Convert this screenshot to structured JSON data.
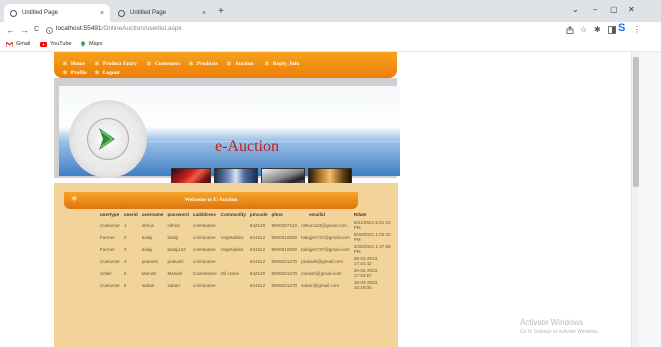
{
  "browser": {
    "tabs": [
      {
        "title": "Untitled Page",
        "close": "×"
      },
      {
        "title": "Untitled Page",
        "close": "×"
      }
    ],
    "new_tab": "+",
    "window_controls": [
      "⌄",
      "–",
      "▢",
      "✕"
    ],
    "nav": {
      "back": "←",
      "forward": "→",
      "reload": "C"
    },
    "url_host": "localhost:55491",
    "url_path": "/OnlineAuction/userlist.aspx",
    "bookmarks": [
      "Gmail",
      "YouTube",
      "Maps"
    ],
    "colors": {
      "gmail": "#d93025",
      "youtube": "#ff0000",
      "maps": "#34a853"
    }
  },
  "site": {
    "menu": [
      "Home",
      "Product Entry",
      "Customers",
      "Products",
      "Auction",
      "Reply_Info",
      "Profile",
      "Logout"
    ],
    "title": "e-Auction"
  },
  "panel": {
    "title": "Welcome to E-Auction",
    "table": {
      "headers": [
        "usertype",
        "userid",
        "username",
        "password",
        "cadddress",
        "Commodity",
        "pincode",
        "phno",
        "emailid",
        "Rdate"
      ],
      "rows": [
        [
          "Customer",
          "1",
          "nithun",
          "nithun",
          "coimbatore",
          "",
          "642120",
          "9600287410",
          "nithun123@gmail.com",
          "8/31/2021 5:51:24 PM"
        ],
        [
          "Farmer",
          "2",
          "balaji",
          "balaji",
          "coimbatore",
          "Vegetables",
          "641012",
          "9600010000",
          "balajjvs737@gmail.com",
          "8/29/2021 1:02:42 PM"
        ],
        [
          "Farmer",
          "3",
          "balaji",
          "balaji123",
          "coimbatore",
          "Vegetables",
          "641012",
          "9600010000",
          "balajjvs737@gmail.com",
          "3/25/2021 1:47:55 PM"
        ],
        [
          "Customer",
          "4",
          "prakash",
          "prakash",
          "coimbatore",
          "",
          "641012",
          "8608231470",
          "prakash@gmail.com",
          "26-03-2023 17:44:42"
        ],
        [
          "Seller",
          "5",
          "Manish",
          "Manish",
          "Coimbatore",
          "Oil crane",
          "642120",
          "8608231470",
          "manish@gmail.com",
          "26-03-2023 17:44:57"
        ],
        [
          "Customer",
          "6",
          "sabari",
          "sabari",
          "coimbatore",
          "",
          "641012",
          "8608231470",
          "sabari@gmail.com",
          "19-04-2023 16:18:05"
        ]
      ]
    }
  },
  "watermark": {
    "line1": "Activate Windows",
    "line2": "Go to Settings to activate Windows."
  }
}
